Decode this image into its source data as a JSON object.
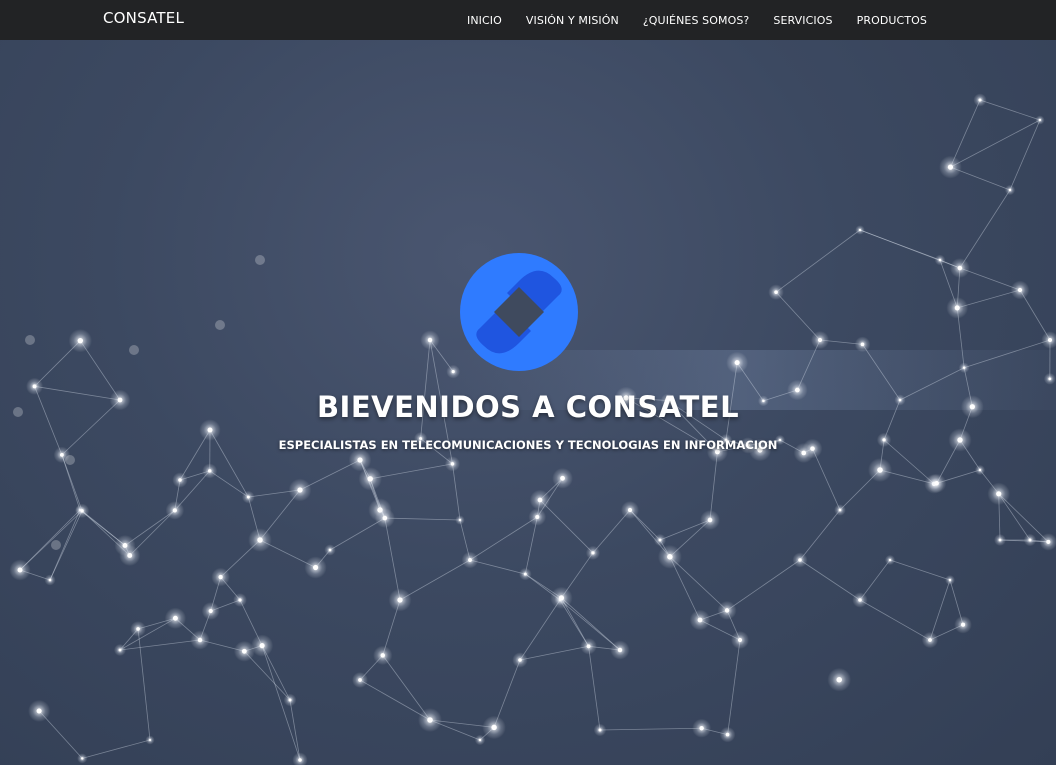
{
  "navbar": {
    "brand": "CONSATEL",
    "links": [
      {
        "label": "INICIO"
      },
      {
        "label": "VISIÓN Y MISIÓN"
      },
      {
        "label": "¿QUIÉNES SOMOS?"
      },
      {
        "label": "SERVICIOS"
      },
      {
        "label": "PRODUCTOS"
      }
    ]
  },
  "hero": {
    "title": "BIEVENIDOS A CONSATEL",
    "subtitle": "ESPECIALISTAS EN TELECOMUNICACIONES Y TECNOLOGIAS EN INFORMACION",
    "logo_icon": "diamond-logo-icon",
    "background": "network-graph-image"
  },
  "colors": {
    "navbar_bg": "#222325",
    "hero_bg": "#3c4961",
    "logo_blue": "#2f7bff",
    "logo_dark_blue": "#1f55e0",
    "text": "#ffffff"
  }
}
